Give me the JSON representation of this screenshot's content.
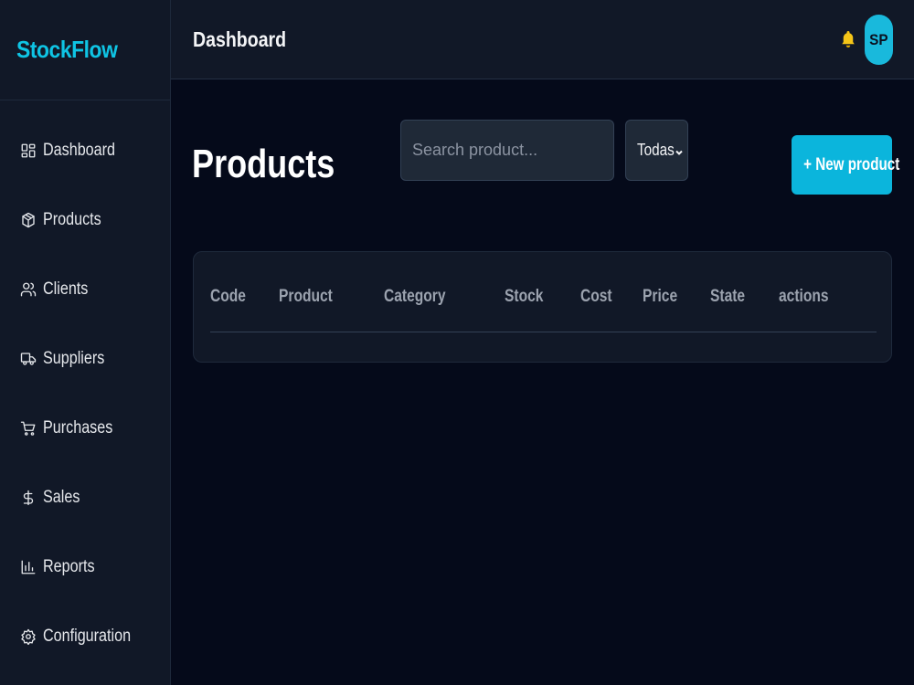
{
  "app": {
    "brand": "StockFlow"
  },
  "sidebar": {
    "items": [
      {
        "label": "Dashboard",
        "icon": "dashboard-grid-icon"
      },
      {
        "label": "Products",
        "icon": "package-icon"
      },
      {
        "label": "Clients",
        "icon": "users-icon"
      },
      {
        "label": "Suppliers",
        "icon": "truck-icon"
      },
      {
        "label": "Purchases",
        "icon": "cart-icon"
      },
      {
        "label": "Sales",
        "icon": "dollar-icon"
      },
      {
        "label": "Reports",
        "icon": "bar-chart-icon"
      },
      {
        "label": "Configuration",
        "icon": "gear-icon"
      }
    ]
  },
  "header": {
    "title": "Dashboard",
    "notification_icon": "bell-icon",
    "avatar_initials": "SP"
  },
  "main": {
    "title": "Products",
    "search": {
      "placeholder": "Search product...",
      "value": ""
    },
    "category_filter": {
      "selected": "Todas"
    },
    "new_button": "+ New product",
    "table": {
      "columns": [
        "Code",
        "Product",
        "Category",
        "Stock",
        "Cost",
        "Price",
        "State",
        "actions"
      ],
      "rows": []
    }
  },
  "colors": {
    "accent": "#0bb5dc",
    "background": "#050a1a",
    "sidebar": "#111827",
    "bell": "#f5c518"
  }
}
